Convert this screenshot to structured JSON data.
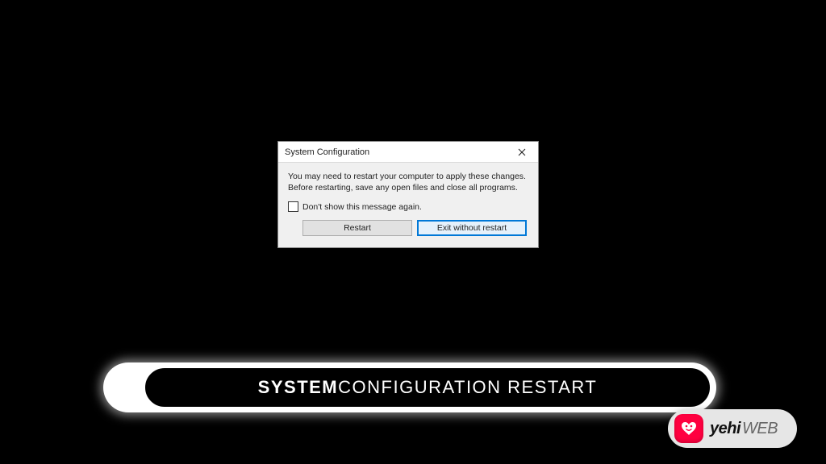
{
  "dialog": {
    "title": "System Configuration",
    "message_line1": "You may need to restart your computer to apply these changes.",
    "message_line2": "Before restarting, save any open files and close all programs.",
    "checkbox_label": "Don't show this message again.",
    "restart_label": "Restart",
    "exit_label": "Exit without restart"
  },
  "banner": {
    "bold_text": "SYSTEM",
    "normal_text": " CONFIGURATION RESTART"
  },
  "watermark": {
    "brand_bold": "yehi",
    "brand_light": "WEB"
  }
}
